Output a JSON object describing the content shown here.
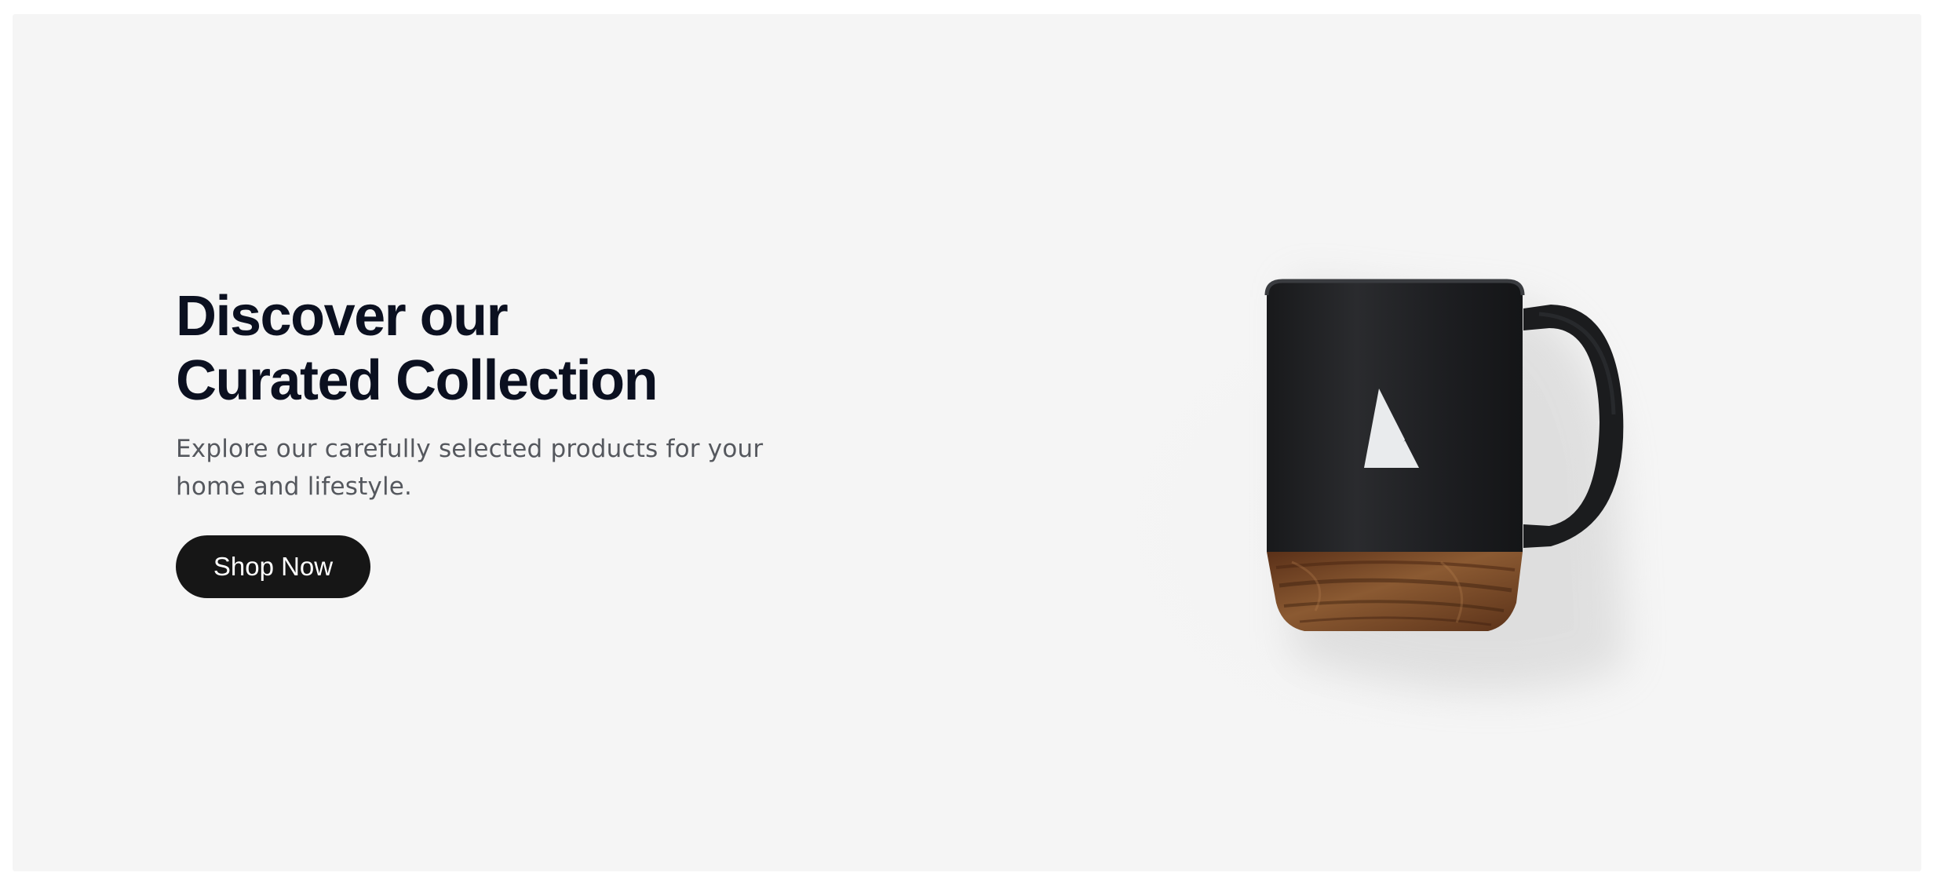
{
  "hero": {
    "headline_line1": "Discover our",
    "headline_line2": "Curated Collection",
    "subtext": "Explore our carefully selected products for your home and lifestyle.",
    "cta_label": "Shop Now"
  },
  "image": {
    "subject": "black-mug-with-wood-base",
    "logo_icon": "triangle-mark-icon"
  },
  "colors": {
    "background": "#f5f5f5",
    "headline": "#0b1020",
    "subtext": "#55585e",
    "button": "#161616",
    "button_text": "#ffffff",
    "mug": "#1f2022",
    "wood": "#7a4a2a"
  }
}
